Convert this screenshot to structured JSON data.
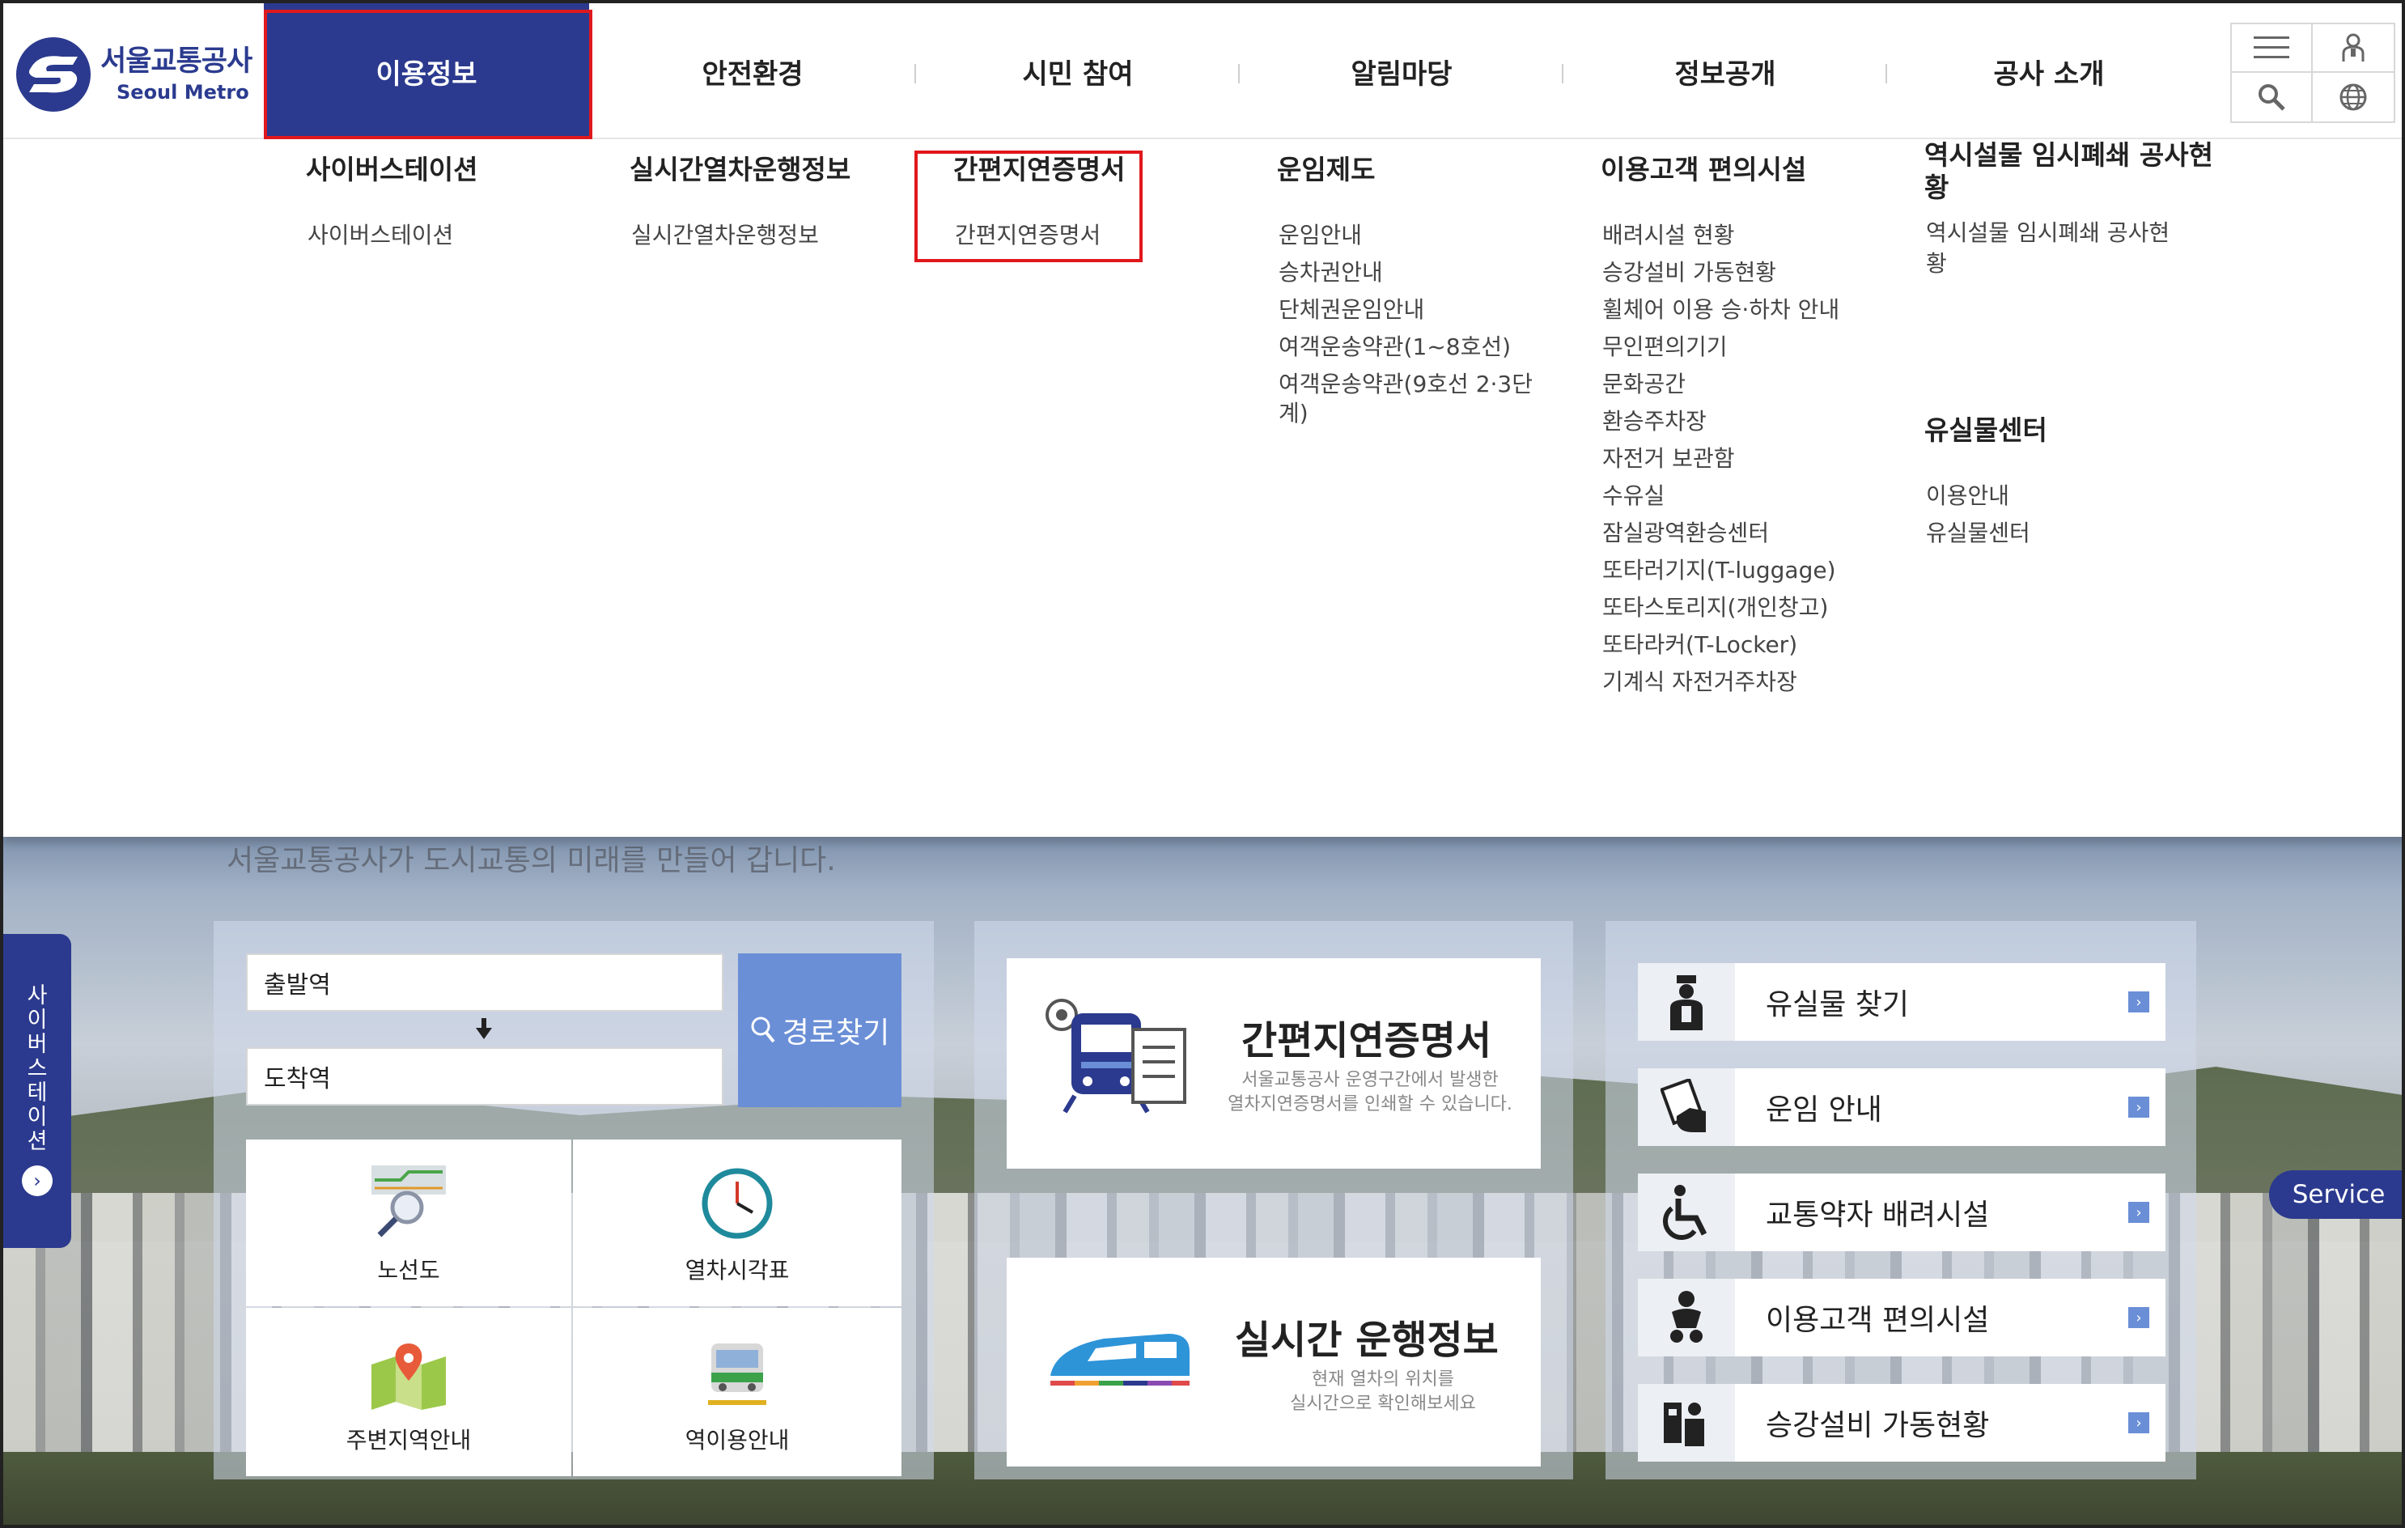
{
  "logo": {
    "ko": "서울교통공사",
    "en": "Seoul Metro"
  },
  "nav": [
    {
      "label": "이용정보"
    },
    {
      "label": "안전환경"
    },
    {
      "label": "시민 참여"
    },
    {
      "label": "알림마당"
    },
    {
      "label": "정보공개"
    },
    {
      "label": "공사 소개"
    }
  ],
  "util": {
    "icons": [
      "menu-icon",
      "user-icon",
      "search-icon",
      "globe-icon"
    ]
  },
  "mega": {
    "cols": [
      {
        "title": "사이버스테이션",
        "items": [
          "사이버스테이션"
        ]
      },
      {
        "title": "실시간열차운행정보",
        "items": [
          "실시간열차운행정보"
        ]
      },
      {
        "title": "간편지연증명서",
        "items": [
          "간편지연증명서"
        ]
      },
      {
        "title": "운임제도",
        "items": [
          "운임안내",
          "승차권안내",
          "단체권운임안내",
          "여객운송약관(1~8호선)",
          "여객운송약관(9호선 2·3단",
          "계)"
        ]
      },
      {
        "title": "이용고객 편의시설",
        "items": [
          "배려시설 현황",
          "승강설비 가동현황",
          "휠체어 이용 승·하차 안내",
          "무인편의기기",
          "문화공간",
          "환승주차장",
          "자전거 보관함",
          "수유실",
          "잠실광역환승센터",
          "또타러기지(T-luggage)",
          "또타스토리지(개인창고)",
          "또타라커(T-Locker)",
          "기계식 자전거주차장"
        ]
      },
      {
        "title_line1": "역시설물 임시폐쇄 공사현",
        "title_line2": "황",
        "items": [
          "역시설물 임시폐쇄 공사현",
          "황"
        ]
      },
      {
        "title": "유실물센터",
        "items": [
          "이용안내",
          "유실물센터"
        ]
      }
    ]
  },
  "hero": {
    "faded_text": "서울교통공사가 도시교통의 미래를 만들어 갑니다."
  },
  "route": {
    "from_placeholder": "출발역",
    "to_placeholder": "도착역",
    "button": "경로찾기"
  },
  "quick": [
    "노선도",
    "열차시각표",
    "주변지역안내",
    "역이용안내"
  ],
  "banners": [
    {
      "title": "간편지연증명서",
      "desc1": "서울교통공사 운영구간에서 발생한",
      "desc2": "열차지연증명서를 인쇄할 수 있습니다."
    },
    {
      "title": "실시간 운행정보",
      "desc1": "현재 열차의 위치를",
      "desc2": "실시간으로 확인해보세요"
    }
  ],
  "services": [
    "유실물 찾기",
    "운임 안내",
    "교통약자 배려시설",
    "이용고객 편의시설",
    "승강설비 가동현황"
  ],
  "side_tab": "사이버스테이션",
  "service_label": "Service",
  "colors": {
    "brand": "#2b3a8e",
    "highlight": "#e0181d",
    "accent": "#6a8fd6"
  }
}
